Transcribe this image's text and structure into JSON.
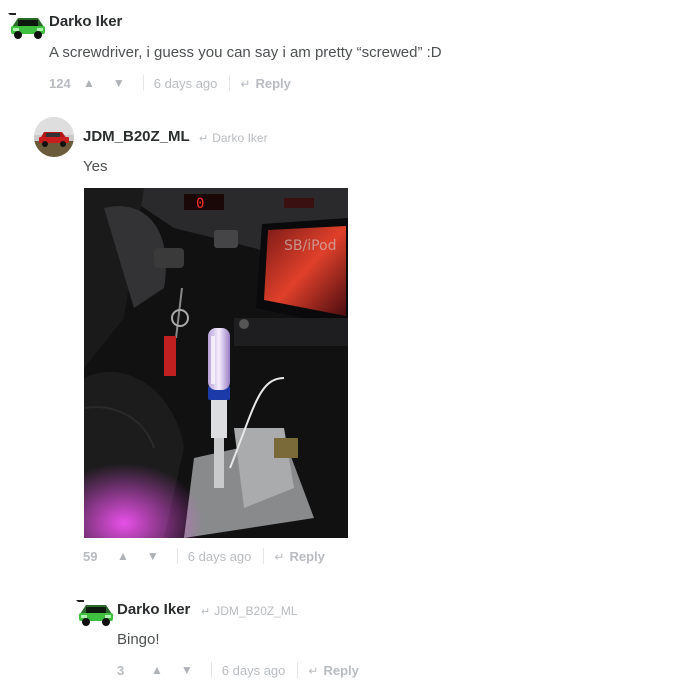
{
  "comments": [
    {
      "author": "Darko Iker",
      "text": "A screwdriver, i guess you can say i am pretty “screwed” :D",
      "votes": "124",
      "time": "6 days ago",
      "reply_label": "Reply"
    },
    {
      "author": "JDM_B20Z_ML",
      "reply_to": "Darko Iker",
      "text": "Yes",
      "votes": "59",
      "time": "6 days ago",
      "reply_label": "Reply"
    },
    {
      "author": "Darko Iker",
      "reply_to": "JDM_B20Z_ML",
      "text": "Bingo!",
      "votes": "3",
      "time": "6 days ago",
      "reply_label": "Reply"
    }
  ],
  "icons": {
    "upvote": "triangle-up-icon",
    "downvote": "triangle-down-icon",
    "reply": "reply-arrow-icon",
    "reply_to": "reply-arrow-icon"
  },
  "colors": {
    "meta_text": "#b8bcc0",
    "author_text": "#2a2e2e",
    "body_text": "#4d5152",
    "avatar_green": "#3fbf3f"
  }
}
